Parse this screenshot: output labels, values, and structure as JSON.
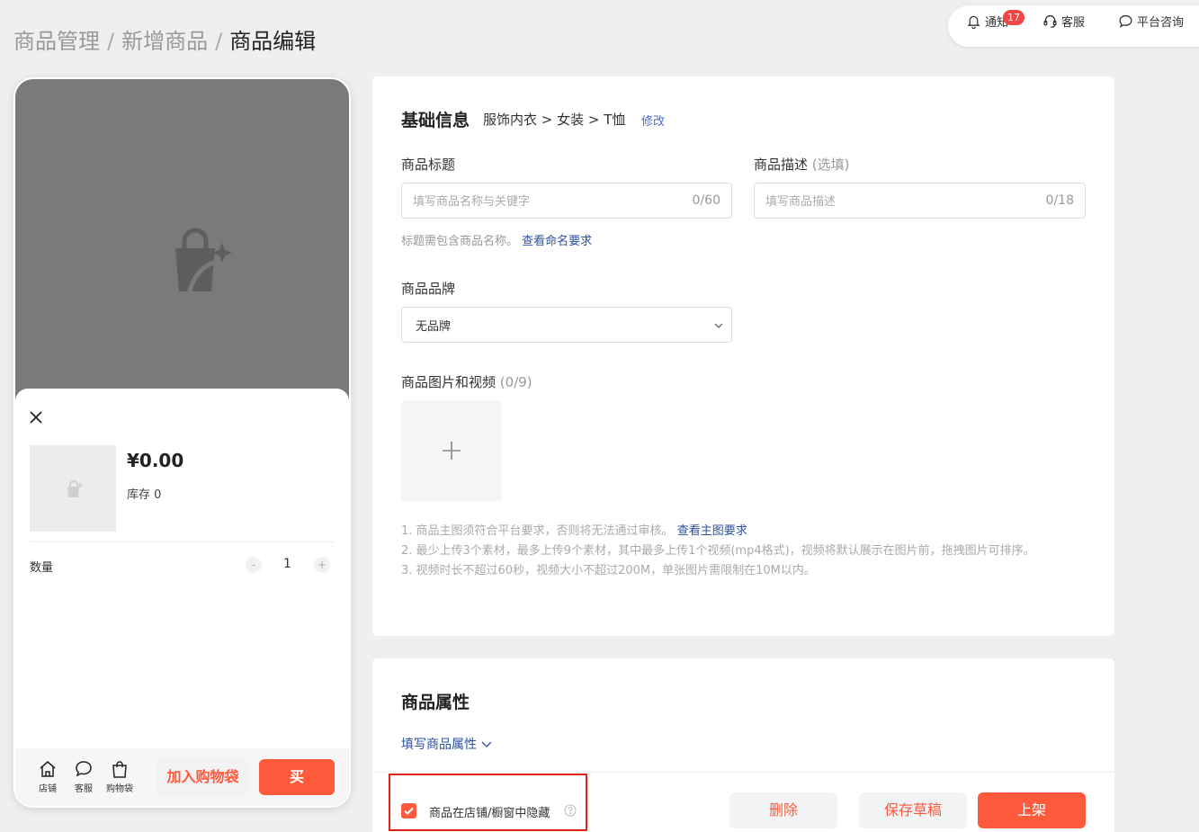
{
  "breadcrumb": {
    "item1": "商品管理",
    "item2": "新增商品",
    "current": "商品编辑",
    "separator": "/"
  },
  "topbar": {
    "notify": "通知",
    "notify_badge": "17",
    "service": "客服",
    "consult": "平台咨询"
  },
  "preview": {
    "price": "¥0.00",
    "stock": "库存 0",
    "quantity_label": "数量",
    "quantity": "1",
    "minus": "-",
    "plus": "+",
    "footer": {
      "shop": "店铺",
      "service": "客服",
      "bag": "购物袋",
      "add_to_cart": "加入购物袋",
      "buy": "买"
    }
  },
  "basic_info": {
    "title": "基础信息",
    "category_path": "服饰内衣 > 女装 > T恤",
    "edit": "修改",
    "product_title": {
      "label": "商品标题",
      "placeholder": "填写商品名称与关键字",
      "counter": "0/60",
      "hint": "标题需包含商品名称。",
      "hint_link": "查看命名要求"
    },
    "product_desc": {
      "label": "商品描述",
      "optional": "(选填)",
      "placeholder": "填写商品描述",
      "counter": "0/18"
    },
    "brand": {
      "label": "商品品牌",
      "value": "无品牌"
    },
    "media": {
      "label": "商品图片和视频",
      "count": "(0/9)",
      "note1": "1. 商品主图须符合平台要求，否则将无法通过审核。",
      "note1_link": "查看主图要求",
      "note2": "2. 最少上传3个素材，最多上传9个素材，其中最多上传1个视频(mp4格式)，视频将默认展示在图片前，拖拽图片可排序。",
      "note3": "3. 视频时长不超过60秒，视频大小不超过200M，单张图片需限制在10M以内。"
    }
  },
  "attributes": {
    "title": "商品属性",
    "toggle": "填写商品属性"
  },
  "actions": {
    "hide_label": "商品在店铺/橱窗中隐藏",
    "delete": "删除",
    "save_draft": "保存草稿",
    "publish": "上架"
  },
  "colors": {
    "accent": "#ff5a3c",
    "link": "#2c4ea3",
    "badge": "#f04646"
  }
}
